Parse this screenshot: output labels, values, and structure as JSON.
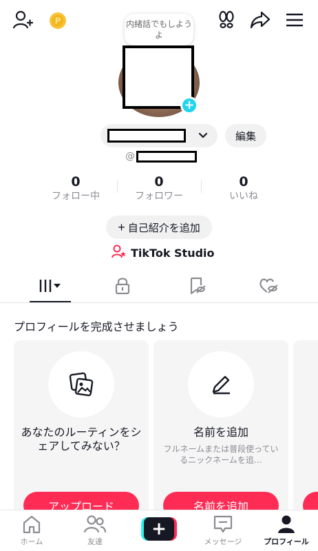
{
  "header": {
    "icons": [
      "add-user-icon",
      "coin-icon",
      "footprints-icon",
      "share-icon",
      "menu-icon"
    ]
  },
  "profile": {
    "note_bubble": "内緒話でもしようよ",
    "avatar_plus": "+",
    "handle_prefix": "@",
    "edit_label": "編集"
  },
  "stats": [
    {
      "value": "0",
      "label": "フォロー中"
    },
    {
      "value": "0",
      "label": "フォロワー"
    },
    {
      "value": "0",
      "label": "いいね"
    }
  ],
  "bio_button": {
    "plus": "+",
    "label": "自己紹介を追加"
  },
  "studio": {
    "label": "TikTok Studio"
  },
  "tabs": [
    {
      "name": "videos",
      "icon": "grid-icon",
      "active": true
    },
    {
      "name": "private",
      "icon": "lock-icon",
      "active": false
    },
    {
      "name": "favorites",
      "icon": "bookmark-icon",
      "active": false
    },
    {
      "name": "liked",
      "icon": "liked-hidden-icon",
      "active": false
    }
  ],
  "complete_profile": {
    "title": "プロフィールを完成させましょう",
    "cards": [
      {
        "icon": "photos-icon",
        "title": "あなたのルーティンをシェアしてみない？",
        "description": "",
        "button": "アップロード"
      },
      {
        "icon": "pencil-icon",
        "title": "名前を追加",
        "description": "フルネームまたは普段使っているニックネームを追…",
        "button": "名前を追加"
      }
    ]
  },
  "bottom_nav": [
    {
      "label": "ホーム",
      "icon": "home-icon",
      "active": false
    },
    {
      "label": "友達",
      "icon": "friends-icon",
      "active": false
    },
    {
      "label": "",
      "icon": "create-icon",
      "active": false
    },
    {
      "label": "メッセージ",
      "icon": "inbox-icon",
      "active": false
    },
    {
      "label": "プロフィール",
      "icon": "profile-icon",
      "active": true
    }
  ],
  "create_plus": "+",
  "colors": {
    "accent": "#fe2c55",
    "cyan": "#25f4ee",
    "text": "#161823",
    "muted": "#8a8b91"
  }
}
